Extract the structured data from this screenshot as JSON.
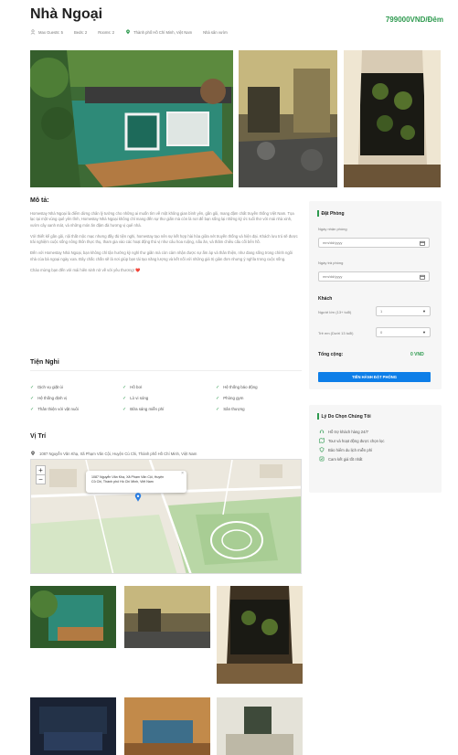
{
  "header": {
    "title": "Nhà Ngoại",
    "price": "799000VND/Đêm",
    "max_guests": "Max Guests: 5",
    "beds": "Beds: 2",
    "rooms": "Rooms: 2",
    "location": "Thành phố Hồ Chí Minh, Việt Nam",
    "category": "Nhà sân vườn"
  },
  "description": {
    "title": "Mô tả:",
    "p1": "Homestay Nhà Ngoại là điểm dừng chân lý tưởng cho những ai muốn tìm về một không gian bình yên, gần gũi, mang đậm chất truyền thống Việt Nam. Tọa lạc tại một vùng quê yên tĩnh, Homestay Nhà Ngoại không chỉ mang đến sự thư giãn mà còn là nơi để bạn sống lại những ký ức tuổi thơ với mái nhà xinh, vườn cây xanh mát, và những món ăn đậm đà hương vị quê nhà.",
    "p2": "Với thiết kế gần gũi, nội thất mộc mạc nhưng đầy đủ tiện nghi, homestay tạo nên sự kết hợp hài hòa giữa nét truyền thống và hiện đại. Khách lưu trú sẽ được trải nghiệm cuộc sống nông thôn thực thụ, tham gia vào các hoạt động thú vị như câu hoa ruộng, nấu ăn, và thăm chiêu cấu cối bên hồ.",
    "p3": "Đến với Homestay Nhà Ngoại, bạn không chỉ tận hưởng kỳ nghỉ thư giãn mà còn cảm nhận được sự ấm áp và thân thiện, như đang sống trong chính ngôi nhà của bà ngoại ngày xưa. Đây chắc chắn sẽ là nơi giúp bạn tái tạo năng lượng và kết nối với những giá trị giản đơn nhưng ý nghĩa trong cuộc sống.",
    "p4": "Chào mừng bạn đến với mái hiên sinh nở về với yêu thương! ❤️"
  },
  "amenities": {
    "title": "Tiện Nghi",
    "items": [
      "Dịch vụ giặt ủi",
      "Hồ bơi",
      "Hệ thống báo động",
      "Hệ thống định vị",
      "Lò vi sóng",
      "Phòng gym",
      "Thân thiện với vật nuôi",
      "Bữa sáng miễn phí",
      "Sân thượng"
    ]
  },
  "location": {
    "title": "Vị Trí",
    "address": "1087 Nguyễn Văn Khạ, Xã Phạm Văn Cội, Huyện Củ Chi, Thành phố Hồ Chí Minh, Việt Nam",
    "popup_line1": "1087 Nguyễn Văn Khạ, Xã Phạm Văn Cội, Huyện",
    "popup_line2": "Củ Chi, Thành phố Hồ Chí Minh, Việt Nam",
    "zoom_in": "+",
    "zoom_out": "−"
  },
  "booking": {
    "title": "Đặt Phòng",
    "checkin_label": "Ngày nhận phòng",
    "checkin_placeholder": "mm/dd/yyyy",
    "checkout_label": "Ngày trả phòng",
    "checkout_placeholder": "mm/dd/yyyy",
    "guests_title": "Khách",
    "adults_label": "Người lớn (13+ tuổi)",
    "adults_value": "1",
    "children_label": "Trẻ em (Dưới 13 tuổi)",
    "children_value": "0",
    "total_label": "Tổng cộng:",
    "total_value": "0 VND",
    "submit": "TIẾN HÀNH ĐẶT PHÒNG"
  },
  "why": {
    "title": "Lý Do Chọn Chúng Tôi",
    "items": [
      "Hỗ trợ khách hàng 24/7",
      "Tour và hoạt động được chọn lọc",
      "Bảo hiểm du lịch miễn phí",
      "Cam kết giá tốt nhất"
    ]
  },
  "colors": {
    "accent_green": "#2e9a4f",
    "button_blue": "#0d7ee8"
  }
}
